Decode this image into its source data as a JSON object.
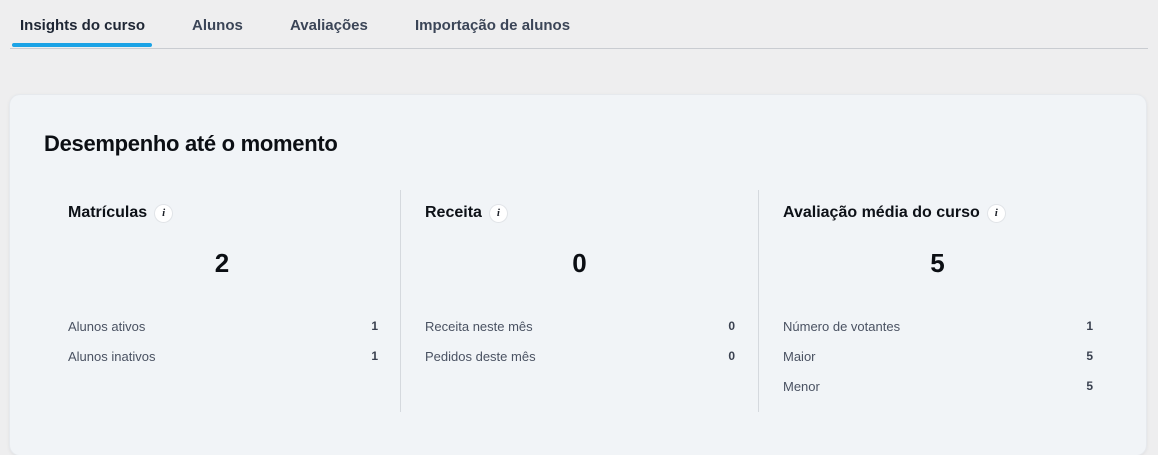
{
  "tabs": [
    {
      "label": "Insights do curso",
      "active": true
    },
    {
      "label": "Alunos",
      "active": false
    },
    {
      "label": "Avaliações",
      "active": false
    },
    {
      "label": "Importação de alunos",
      "active": false
    }
  ],
  "colors": {
    "accent": "#1ba3e6",
    "card_background": "#f1f4f7",
    "page_background": "#eeeeef"
  },
  "card": {
    "title": "Desempenho até o momento",
    "columns": [
      {
        "title": "Matrículas",
        "info_icon": "info-icon",
        "value": "2",
        "stats": [
          {
            "label": "Alunos ativos",
            "value": "1"
          },
          {
            "label": "Alunos inativos",
            "value": "1"
          }
        ]
      },
      {
        "title": "Receita",
        "info_icon": "info-icon",
        "value": "0",
        "stats": [
          {
            "label": "Receita neste mês",
            "value": "0"
          },
          {
            "label": "Pedidos deste mês",
            "value": "0"
          }
        ]
      },
      {
        "title": "Avaliação média do curso",
        "info_icon": "info-icon",
        "value": "5",
        "stats": [
          {
            "label": "Número de votantes",
            "value": "1"
          },
          {
            "label": "Maior",
            "value": "5"
          },
          {
            "label": "Menor",
            "value": "5"
          }
        ]
      }
    ]
  }
}
